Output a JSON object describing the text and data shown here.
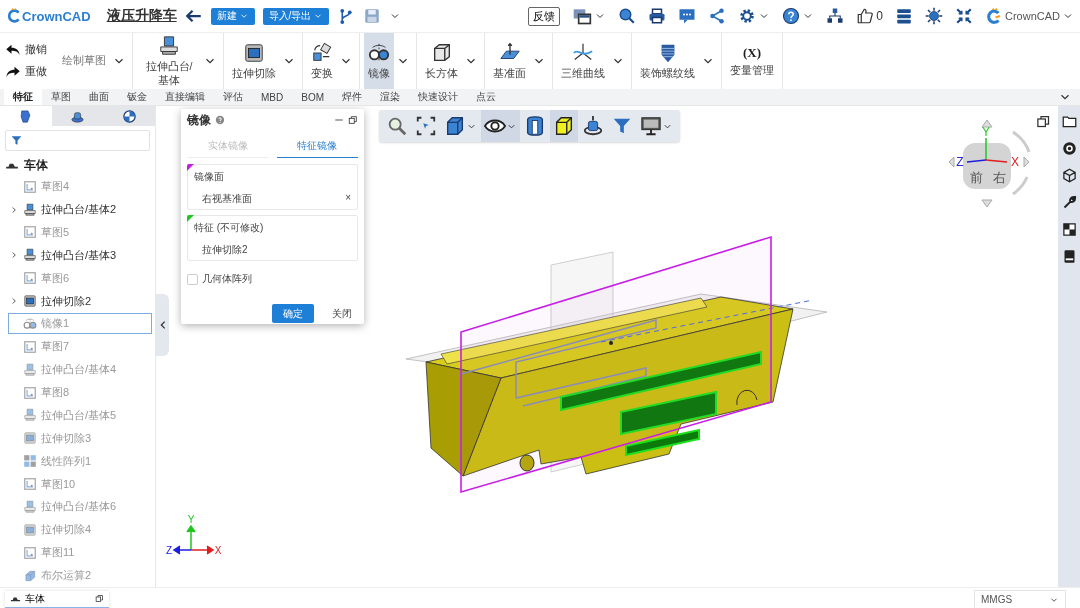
{
  "header": {
    "logo": "CrownCAD",
    "title": "液压升降车",
    "buttons": [
      {
        "label": "新建"
      },
      {
        "label": "导入/导出"
      }
    ],
    "feedback": "反馈",
    "likes": "0",
    "user": "CrownCAD"
  },
  "ribbon": {
    "undo": "撤销",
    "redo": "重做",
    "tools": [
      {
        "label": "绘制草图",
        "kind": "draw",
        "selected": false,
        "dropdown": true
      },
      {
        "label": "拉伸凸台/基体",
        "kind": "extrude",
        "selected": false,
        "dropdown": true
      },
      {
        "label": "拉伸切除",
        "kind": "cut",
        "selected": false,
        "dropdown": true
      },
      {
        "label": "变换",
        "kind": "transform",
        "selected": false,
        "dropdown": true
      },
      {
        "label": "镜像",
        "kind": "mirror",
        "selected": true,
        "dropdown": true
      },
      {
        "label": "长方体",
        "kind": "box",
        "selected": false,
        "dropdown": true
      },
      {
        "label": "基准面",
        "kind": "plane",
        "selected": false,
        "dropdown": true
      },
      {
        "label": "三维曲线",
        "kind": "curve",
        "selected": false,
        "dropdown": true
      },
      {
        "label": "装饰螺纹线",
        "kind": "thread",
        "selected": false,
        "dropdown": true
      },
      {
        "label": "变量管理",
        "kind": "variables",
        "icon_text": "(X)",
        "selected": false,
        "dropdown": false
      }
    ]
  },
  "tabs": [
    {
      "label": "特征",
      "selected": true
    },
    {
      "label": "草图",
      "selected": false
    },
    {
      "label": "曲面",
      "selected": false
    },
    {
      "label": "钣金",
      "selected": false
    },
    {
      "label": "直接编辑",
      "selected": false
    },
    {
      "label": "评估",
      "selected": false
    },
    {
      "label": "MBD",
      "selected": false
    },
    {
      "label": "BOM",
      "selected": false
    },
    {
      "label": "焊件",
      "selected": false
    },
    {
      "label": "渲染",
      "selected": false
    },
    {
      "label": "快速设计",
      "selected": false
    },
    {
      "label": "点云",
      "selected": false
    }
  ],
  "tree": {
    "tabs": [
      {
        "kind": "features",
        "selected": true
      },
      {
        "kind": "assembly",
        "selected": false
      },
      {
        "kind": "appearance",
        "selected": false
      }
    ],
    "root": "车体",
    "items": [
      {
        "label": "草图4",
        "kind": "sketch",
        "dimmed": true,
        "expandable": false,
        "selected": false
      },
      {
        "label": "拉伸凸台/基体2",
        "kind": "extrude",
        "dimmed": false,
        "expandable": true,
        "selected": false
      },
      {
        "label": "草图5",
        "kind": "sketch",
        "dimmed": true,
        "expandable": false,
        "selected": false
      },
      {
        "label": "拉伸凸台/基体3",
        "kind": "extrude",
        "dimmed": false,
        "expandable": true,
        "selected": false
      },
      {
        "label": "草图6",
        "kind": "sketch",
        "dimmed": true,
        "expandable": false,
        "selected": false
      },
      {
        "label": "拉伸切除2",
        "kind": "cut",
        "dimmed": false,
        "expandable": true,
        "selected": false
      },
      {
        "label": "镜像1",
        "kind": "mirror",
        "dimmed": true,
        "expandable": false,
        "selected": true
      },
      {
        "label": "草图7",
        "kind": "sketch",
        "dimmed": true,
        "expandable": false,
        "selected": false
      },
      {
        "label": "拉伸凸台/基体4",
        "kind": "extrude",
        "dimmed": true,
        "expandable": false,
        "selected": false
      },
      {
        "label": "草图8",
        "kind": "sketch",
        "dimmed": true,
        "expandable": false,
        "selected": false
      },
      {
        "label": "拉伸凸台/基体5",
        "kind": "extrude",
        "dimmed": true,
        "expandable": false,
        "selected": false
      },
      {
        "label": "拉伸切除3",
        "kind": "cut",
        "dimmed": true,
        "expandable": false,
        "selected": false
      },
      {
        "label": "线性阵列1",
        "kind": "pattern",
        "dimmed": true,
        "expandable": false,
        "selected": false
      },
      {
        "label": "草图10",
        "kind": "sketch",
        "dimmed": true,
        "expandable": false,
        "selected": false
      },
      {
        "label": "拉伸凸台/基体6",
        "kind": "extrude",
        "dimmed": true,
        "expandable": false,
        "selected": false
      },
      {
        "label": "拉伸切除4",
        "kind": "cut",
        "dimmed": true,
        "expandable": false,
        "selected": false
      },
      {
        "label": "草图11",
        "kind": "sketch",
        "dimmed": true,
        "expandable": false,
        "selected": false
      },
      {
        "label": "布尔运算2",
        "kind": "boolean",
        "dimmed": true,
        "expandable": false,
        "selected": false
      }
    ]
  },
  "dialog": {
    "title": "镜像",
    "tabs": [
      {
        "label": "实体镜像",
        "selected": false
      },
      {
        "label": "特征镜像",
        "selected": true
      }
    ],
    "sections": [
      {
        "label": "镜像面",
        "value": "右视基准面",
        "clear": "×",
        "color": "#c21ee6"
      },
      {
        "label": "特征 (不可修改)",
        "value": "拉伸切除2",
        "color": "#1ec81e"
      }
    ],
    "checkbox": {
      "label": "几何体阵列",
      "checked": false
    },
    "ok": "确定",
    "close": "关闭"
  },
  "viewport": {
    "toolbar": [
      {
        "kind": "zoom",
        "selected": false,
        "dropdown": false
      },
      {
        "kind": "select",
        "selected": false,
        "dropdown": false
      },
      {
        "kind": "cube",
        "selected": false,
        "dropdown": true
      },
      {
        "kind": "eye",
        "selected": true,
        "dropdown": true
      },
      {
        "kind": "section",
        "selected": false,
        "dropdown": false
      },
      {
        "kind": "yellow-cube",
        "selected": true,
        "dropdown": false
      },
      {
        "kind": "rotate",
        "selected": false,
        "dropdown": false
      },
      {
        "kind": "filter",
        "selected": false,
        "dropdown": false
      },
      {
        "kind": "monitor",
        "selected": false,
        "dropdown": true
      }
    ],
    "view_cube": {
      "front": "前",
      "right": "右",
      "x": "X",
      "y": "Y",
      "z": "Z"
    },
    "triad": {
      "x": "X",
      "y": "Y",
      "z": "Z"
    }
  },
  "bottom": {
    "tab": "车体",
    "units": "MMGS"
  }
}
